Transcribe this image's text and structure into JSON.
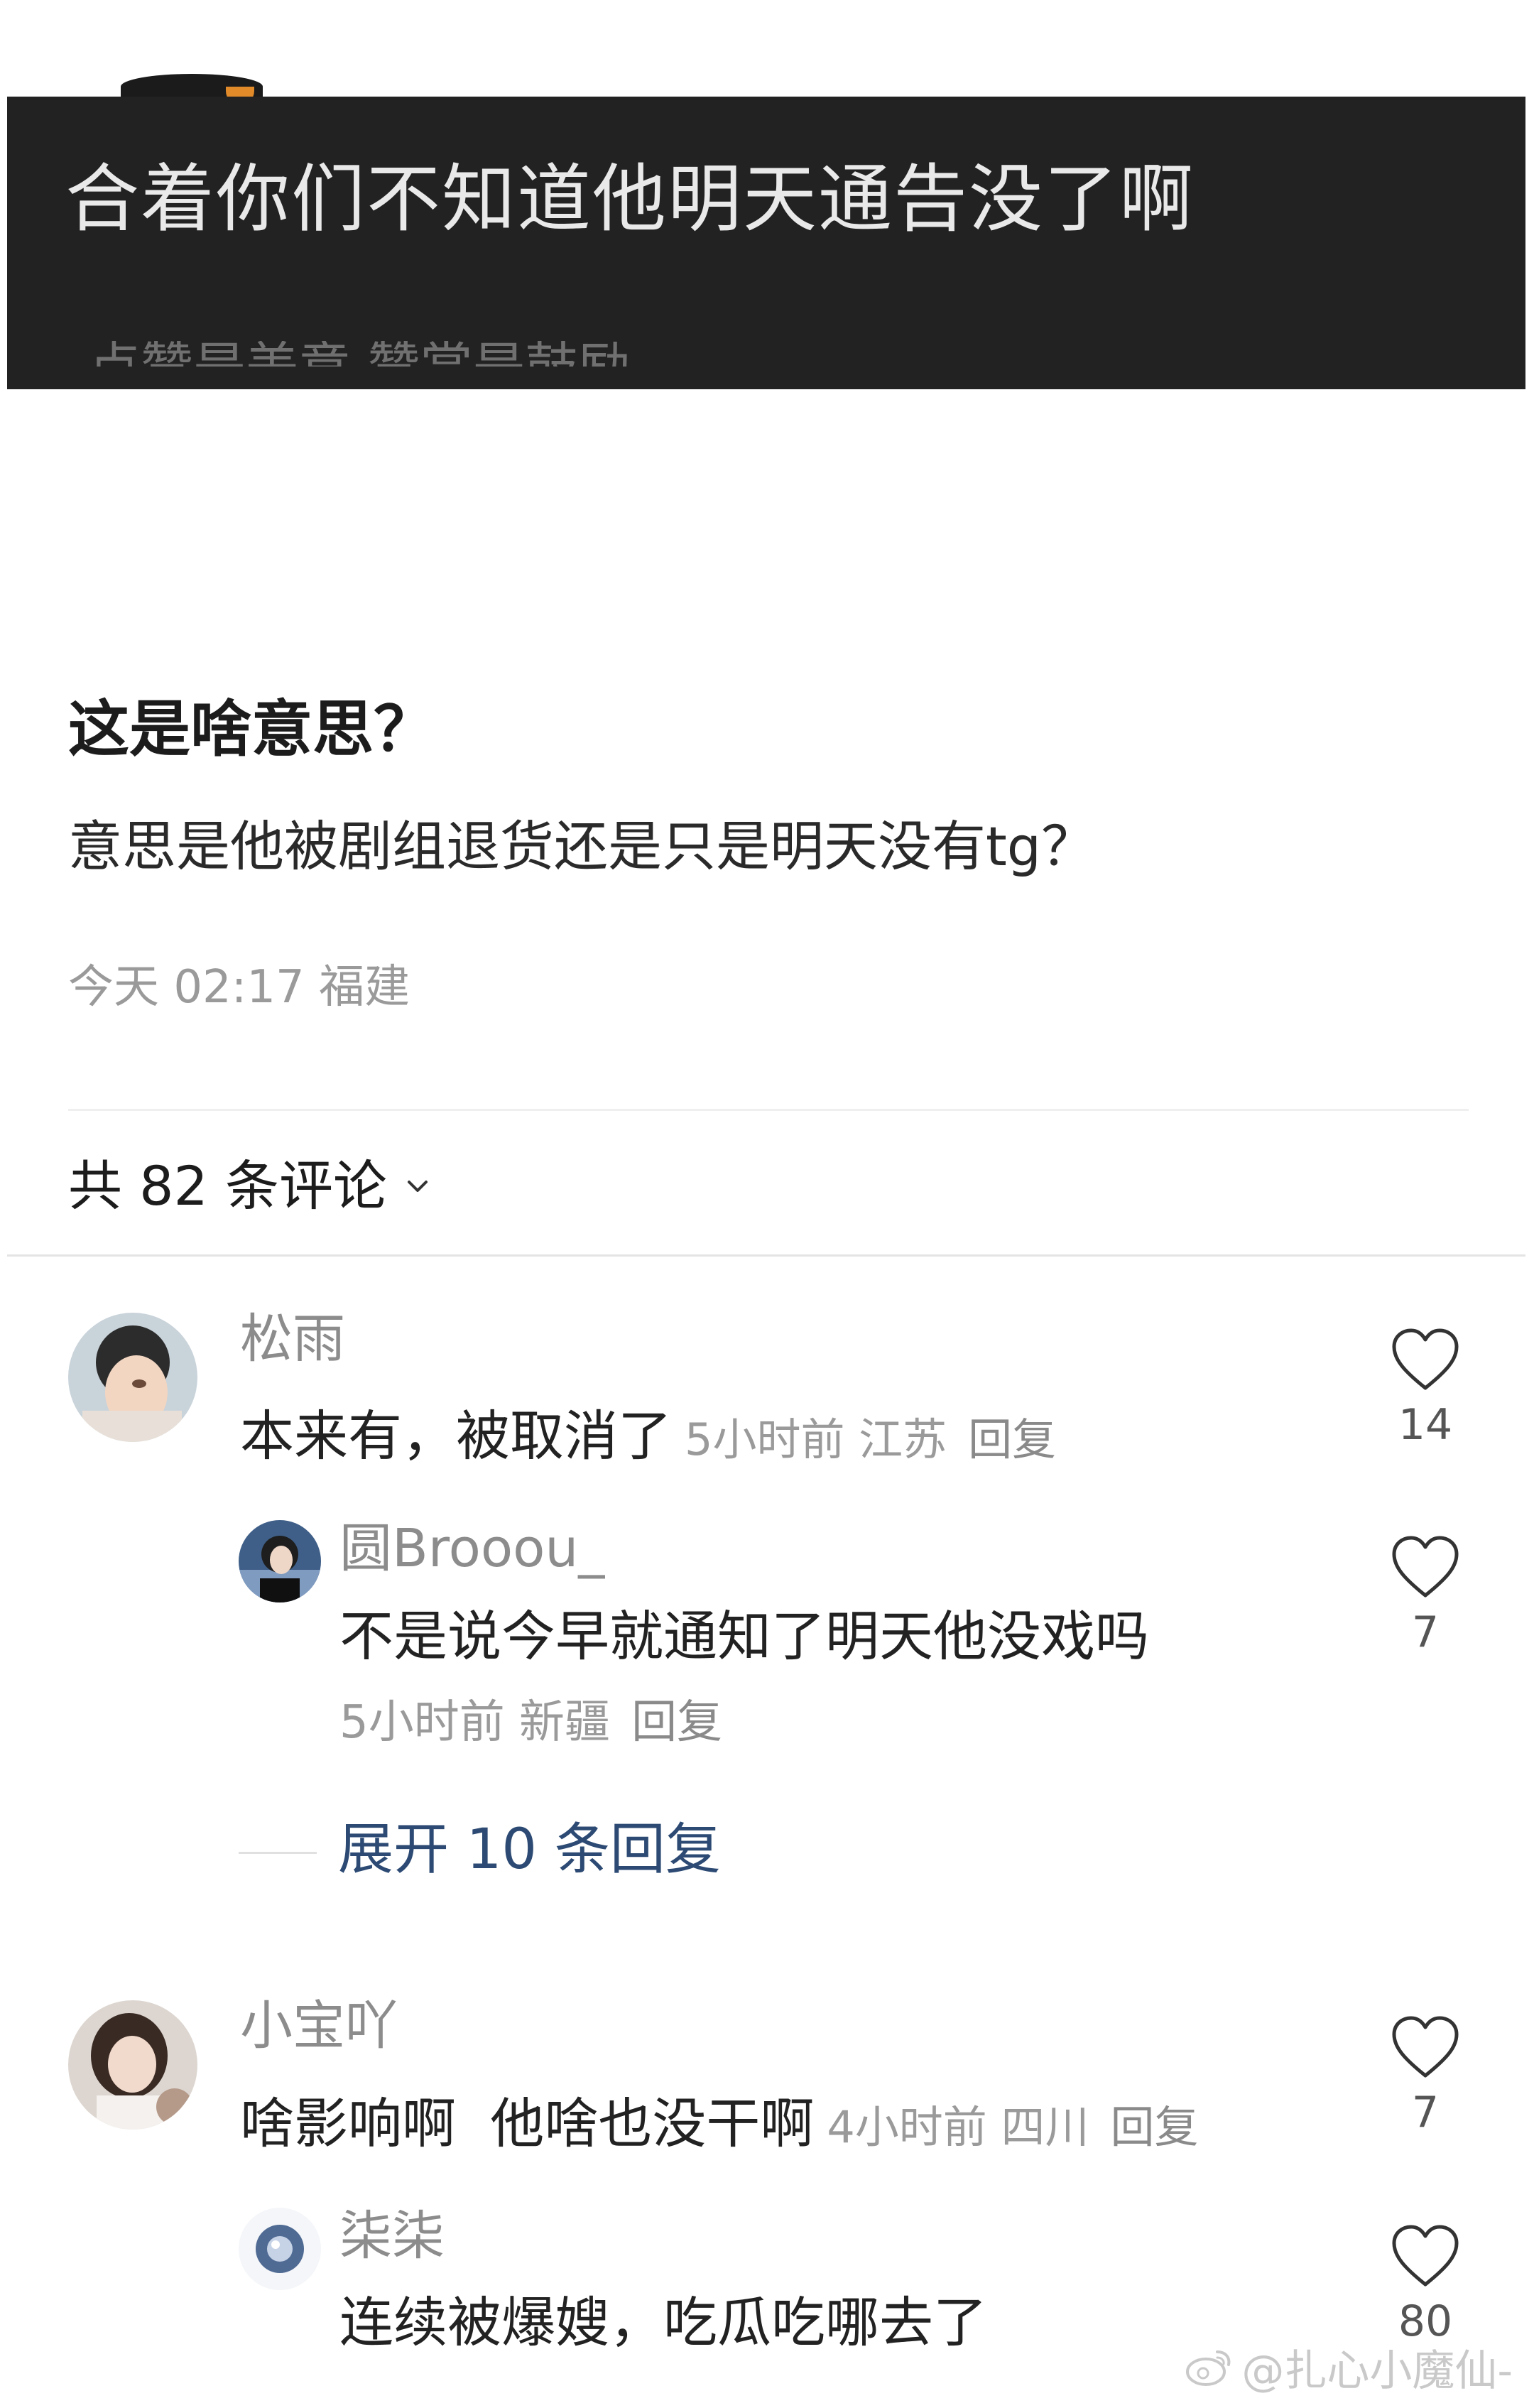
{
  "video": {
    "caption": "合着你们不知道他明天通告没了啊",
    "sub_caption": "点赞是美意    赞赏是鼓励"
  },
  "post": {
    "title": "这是啥意思？",
    "body": "意思是他被剧组退货还是只是明天没有tg？",
    "meta": "今天 02:17 福建"
  },
  "comments_header": {
    "label": "共 82 条评论",
    "icon": "chevron-down-icon"
  },
  "comments": [
    {
      "name": "松雨",
      "text": "本来有，被取消了",
      "time": "5小时前 江苏",
      "reply": "回复",
      "likes": "14",
      "replies": [
        {
          "name": "圆Brooou_",
          "text": "不是说今早就通知了明天他没戏吗",
          "time": "5小时前 新疆",
          "reply": "回复",
          "likes": "7"
        }
      ],
      "expand": "展开 10 条回复"
    },
    {
      "name": "小宝吖",
      "text": "啥影响啊  他啥也没干啊",
      "time": "4小时前 四川",
      "reply": "回复",
      "likes": "7",
      "replies": [
        {
          "name": "柒柒",
          "text": "连续被爆嫂，吃瓜吃哪去了",
          "likes": "80"
        }
      ]
    }
  ],
  "watermark": "@扎心小魔仙-",
  "colors": {
    "banner": "#222222",
    "expand_link": "#2c4a73",
    "muted_text": "#9a9a9a"
  }
}
